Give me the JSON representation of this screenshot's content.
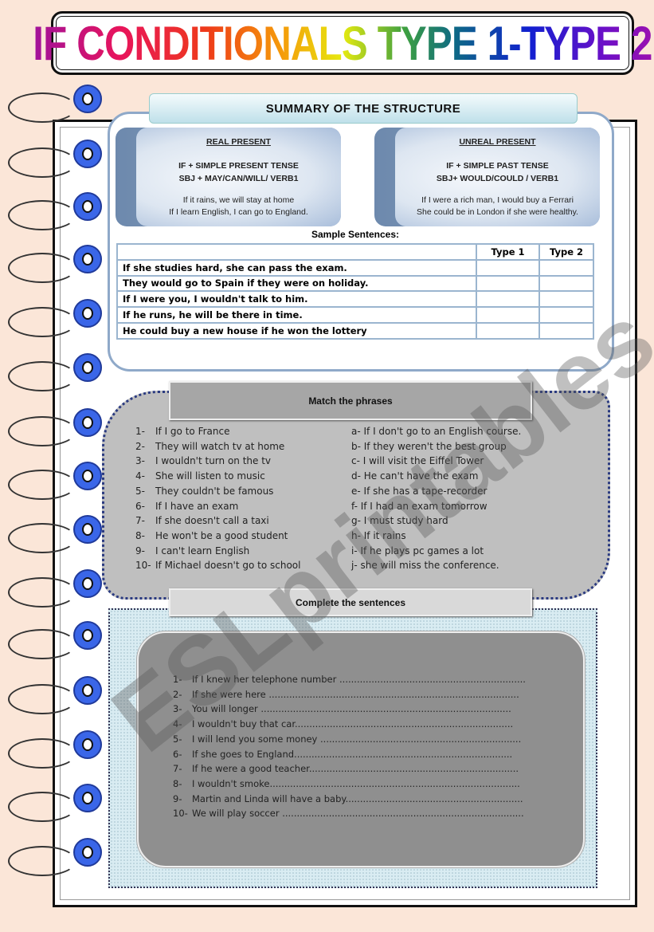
{
  "title": "IF CONDITIONALS TYPE 1-TYPE 2",
  "summary": {
    "heading": "SUMMARY OF THE STRUCTURE",
    "real": {
      "heading": "REAL PRESENT",
      "formula1": "IF + SIMPLE PRESENT TENSE",
      "formula2": "SBJ + MAY/CAN/WILL/ VERB1",
      "example1": "If it rains, we will stay at home",
      "example2": "If I learn English, I can go to England."
    },
    "unreal": {
      "heading": "UNREAL PRESENT",
      "formula1": "IF + SIMPLE PAST TENSE",
      "formula2": "SBJ+ WOULD/COULD / VERB1",
      "example1": "If I were a rich man, I would buy a Ferrari",
      "example2": "She could be in London if she were healthy."
    },
    "sample_label": "Sample Sentences:",
    "table": {
      "headers": [
        "",
        "Type 1",
        "Type 2"
      ],
      "rows": [
        "If she studies hard, she can pass the exam.",
        "They would go to Spain if they were on holiday.",
        "If I were you, I wouldn't talk to him.",
        "If he runs, he will be there in time.",
        "He could buy a new house if he won the lottery"
      ]
    }
  },
  "match": {
    "heading": "Match the phrases",
    "left": [
      [
        "1-",
        "If I go to France"
      ],
      [
        "2-",
        "They will watch tv at home"
      ],
      [
        "3-",
        "I wouldn't turn on the tv"
      ],
      [
        "4-",
        "She will listen to music"
      ],
      [
        "5-",
        "They couldn't be famous"
      ],
      [
        "6-",
        "If I have an exam"
      ],
      [
        "7-",
        "If she doesn't call a taxi"
      ],
      [
        "8-",
        "He won't be a good student"
      ],
      [
        "9-",
        "I can't learn English"
      ],
      [
        "10-",
        "If Michael doesn't go to school"
      ]
    ],
    "right": [
      "a- If I don't go to an English course.",
      "b- If they weren't the best group",
      "c- I will visit the Eiffel Tower",
      "d- He can't have the exam",
      "e- If she has a tape-recorder",
      "f- If I had an exam tomorrow",
      "g- I must study hard",
      "h- If it rains",
      "i-  If he plays pc games a lot",
      "j- she will miss the conference."
    ]
  },
  "complete": {
    "heading": "Complete the sentences",
    "items": [
      [
        "1-",
        "If I knew her telephone number ................................................................"
      ],
      [
        "2-",
        "If she were here ......................................................................................"
      ],
      [
        "3-",
        "You will longer ......................................................................................"
      ],
      [
        "4-",
        "I wouldn't buy that car..........................................................................."
      ],
      [
        "5-",
        "I will lend you some money ....................................................................."
      ],
      [
        "6-",
        "If she goes to England..........................................................................."
      ],
      [
        "7-",
        "If he were a good teacher........................................................................"
      ],
      [
        "8-",
        "I wouldn't smoke......................................................................................"
      ],
      [
        "9-",
        "Martin and Linda will have a baby............................................................."
      ],
      [
        "10-",
        "We will play soccer ..................................................................................."
      ]
    ]
  },
  "watermark": "ESLprintables.com",
  "colors": {
    "background": "#fbe6d8",
    "ring": "#3a66e8",
    "summary_border": "#8fa9c9",
    "match_bg": "#bfbfbf"
  }
}
